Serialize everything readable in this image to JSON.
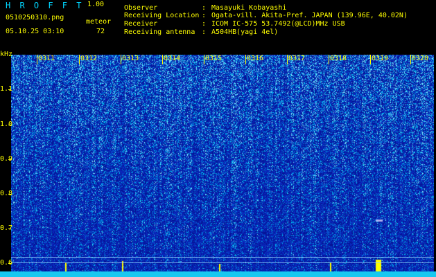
{
  "header": {
    "app_title": "H R O F F T",
    "version": "1.00",
    "filename": "0510250310.png",
    "mode_label": "meteor",
    "datetime": "05.10.25 03:10",
    "meteor_count": "72"
  },
  "info": [
    {
      "key": "Observer",
      "value": "Masayuki Kobayashi"
    },
    {
      "key": "Receiving Location",
      "value": "Ogata-vill. Akita-Pref. JAPAN (139.96E, 40.02N)"
    },
    {
      "key": "Receiver",
      "value": "ICOM IC-575 53.7492(@LCD)MHz USB"
    },
    {
      "key": "Receiving antenna",
      "value": "A504HB(yagi 4el)"
    }
  ],
  "info_separator": ":",
  "axis": {
    "unit": "kHz",
    "y_ticks": [
      "1.1",
      "1.0",
      "0.9",
      "0.8",
      "0.7",
      "0.6"
    ],
    "x_ticks": [
      "0311",
      "0312",
      "0313",
      "0314",
      "0315",
      "0316",
      "0317",
      "0318",
      "0319",
      "0320"
    ]
  },
  "colors": {
    "label": "#ffff00",
    "title": "#00d6ff",
    "spectrogram_base": "#0a1fb0",
    "spectrogram_noise": "#00c8ff",
    "strip": "#18c8f0"
  }
}
